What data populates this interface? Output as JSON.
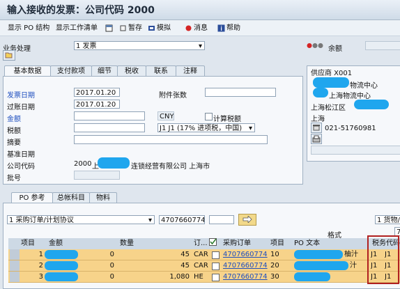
{
  "window": {
    "title": "输入接收的发票：公司代码 2000"
  },
  "toolbar": {
    "items": [
      {
        "label": "显示 PO 结构"
      },
      {
        "label": "显示工作清单"
      },
      {
        "label": ""
      },
      {
        "label": "暂存"
      },
      {
        "label": "模拟"
      },
      {
        "label": "消息"
      },
      {
        "label": "帮助"
      }
    ]
  },
  "header": {
    "business_label": "业务处理",
    "business_value": "1 发票",
    "balance_label": "余额",
    "balance_value": ""
  },
  "tabs_top": [
    "基本数据",
    "支付款项",
    "细节",
    "税收",
    "联系",
    "注释"
  ],
  "basic": {
    "invoice_date_label": "发票日期",
    "invoice_date": "2017.01.20",
    "attachments_label": "附件张数",
    "attachments_value": "",
    "posting_date_label": "过账日期",
    "posting_date": "2017.01.20",
    "amount_label": "金额",
    "amount_value": "",
    "currency": "CNY",
    "calc_tax_label": "计算税额",
    "tax_label": "税额",
    "tax_value": "",
    "tax_code": "J1 J1 (17% 进项税，中国)",
    "text_label": "摘要",
    "text_value": "",
    "baseline_label": "基准日期",
    "company_label": "公司代码",
    "company_code": "2000",
    "company_name_prefix": "上",
    "company_name": "连锁经营有限公司 上海市",
    "batch_label": "批号"
  },
  "vendor": {
    "title": "供应商 X001",
    "line1": "物流中心",
    "line2": "上海物流中心",
    "line3": "上海松江区",
    "line4": "上海",
    "phone": "021-51760981"
  },
  "tabs_bottom": [
    "PO 参考",
    "总帐科目",
    "物料"
  ],
  "po_ref": {
    "type_value": "1 采购订单/计划协议",
    "po_number": "4707660774",
    "extra_value": "",
    "right_value": "1 货物/服",
    "format_label": "格式",
    "layout_value": "7"
  },
  "grid": {
    "columns": [
      "项目",
      "金额",
      "数量",
      "订...",
      "采购订单",
      "项目",
      "PO 文本",
      "税务代码"
    ],
    "rows": [
      {
        "item": "1",
        "amount": "0",
        "qty": "45",
        "unit": "CAR",
        "po": "4707660774",
        "po_item": "10",
        "text": "柚汁",
        "tax1": "J1",
        "tax2": "J1"
      },
      {
        "item": "2",
        "amount": "0",
        "qty": "45",
        "unit": "CAR",
        "po": "4707660774",
        "po_item": "20",
        "text": "汁",
        "tax1": "J1",
        "tax2": "J1"
      },
      {
        "item": "3",
        "amount": "0",
        "qty": "1,080",
        "unit": "HE",
        "po": "4707660774",
        "po_item": "30",
        "text": "",
        "tax1": "J1",
        "tax2": "J1"
      }
    ]
  },
  "colors": {
    "accent_blob": "#1fa6ee",
    "row_highlight": "#f7d38a",
    "frame_red": "#b02020"
  }
}
